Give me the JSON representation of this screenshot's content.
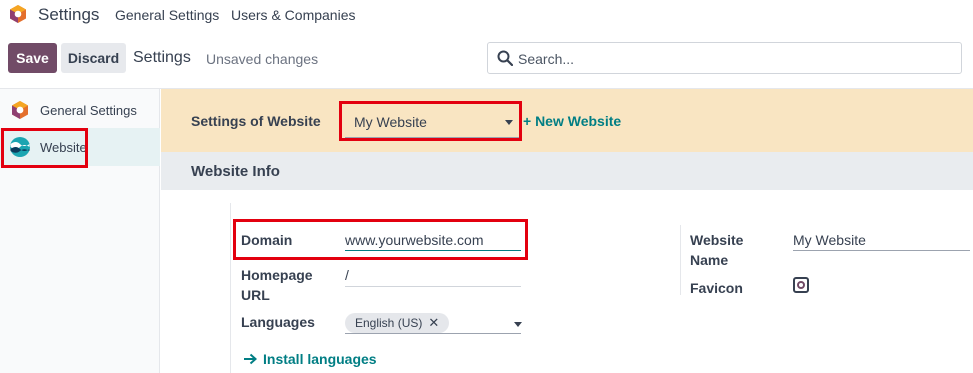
{
  "topnav": {
    "app_title": "Settings",
    "links": [
      "General Settings",
      "Users & Companies"
    ]
  },
  "control": {
    "save_label": "Save",
    "discard_label": "Discard",
    "page_title": "Settings",
    "status": "Unsaved changes",
    "search_placeholder": "Search..."
  },
  "sidebar": {
    "items": [
      {
        "label": "General Settings",
        "icon": "odoo-logo-icon"
      },
      {
        "label": "Website",
        "icon": "website-app-icon",
        "active": true
      }
    ]
  },
  "website_banner": {
    "label": "Settings of Website",
    "selected_website": "My Website",
    "new_website_label": "+ New Website"
  },
  "website_info": {
    "section_title": "Website Info",
    "domain_label": "Domain",
    "domain_value": "www.yourwebsite.com",
    "homepage_label": "Homepage URL",
    "homepage_label_line1": "Homepage",
    "homepage_label_line2": "URL",
    "homepage_value": "/",
    "languages_label": "Languages",
    "language_tag": "English (US)",
    "install_languages": "Install languages",
    "website_name_label_line1": "Website",
    "website_name_label_line2": "Name",
    "website_name_value": "My Website",
    "favicon_label": "Favicon"
  },
  "colors": {
    "primary": "#714b67",
    "link": "#017e84",
    "highlight": "#e3000f",
    "banner": "#f9e5c2"
  }
}
